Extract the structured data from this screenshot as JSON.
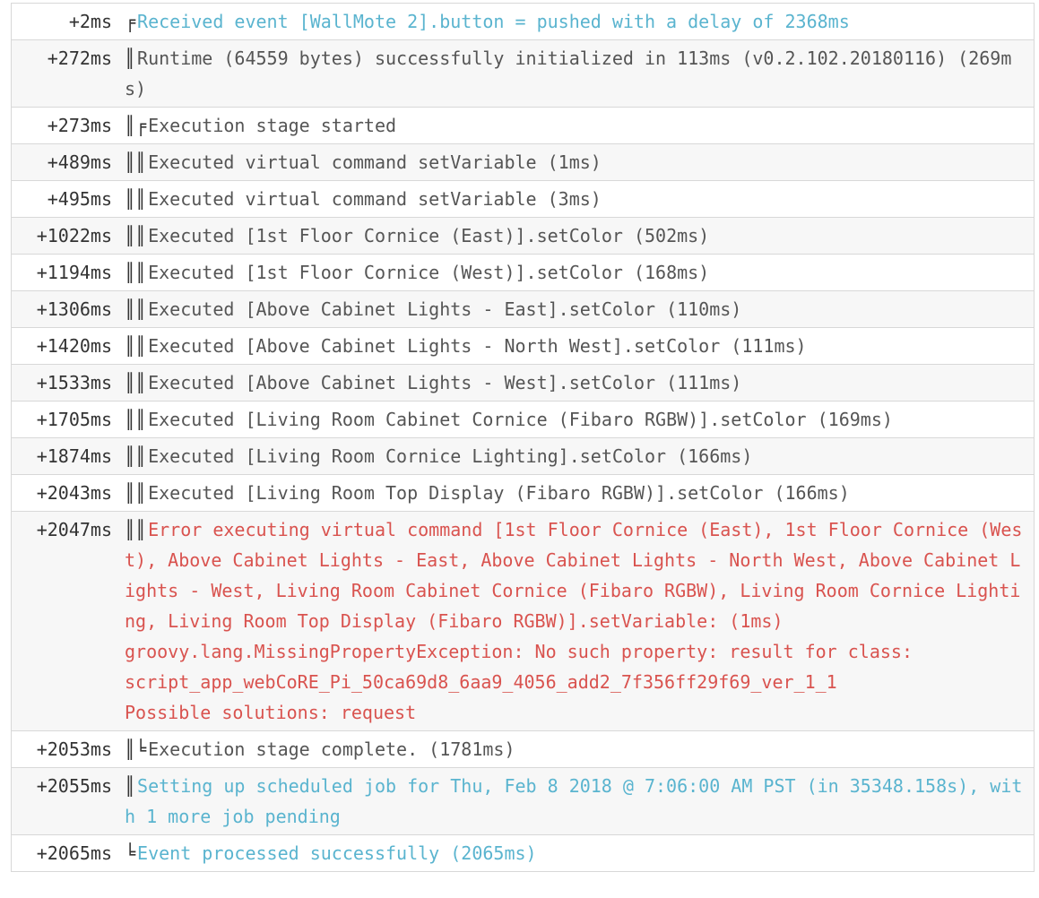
{
  "log": {
    "rows": [
      {
        "ts": "+2ms",
        "gutter": "╒",
        "msg": "Received event [WallMote 2].button = pushed with a delay of 2368ms",
        "level": "event"
      },
      {
        "ts": "+272ms",
        "gutter": "║",
        "msg": "Runtime (64559 bytes) successfully initialized in 113ms (v0.2.102.20180116) (269ms)",
        "level": "info"
      },
      {
        "ts": "+273ms",
        "gutter": "║╒",
        "msg": "Execution stage started",
        "level": "info"
      },
      {
        "ts": "+489ms",
        "gutter": "║║",
        "msg": "Executed virtual command setVariable (1ms)",
        "level": "info"
      },
      {
        "ts": "+495ms",
        "gutter": "║║",
        "msg": "Executed virtual command setVariable (3ms)",
        "level": "info"
      },
      {
        "ts": "+1022ms",
        "gutter": "║║",
        "msg": "Executed [1st Floor Cornice (East)].setColor (502ms)",
        "level": "info"
      },
      {
        "ts": "+1194ms",
        "gutter": "║║",
        "msg": "Executed [1st Floor Cornice (West)].setColor (168ms)",
        "level": "info"
      },
      {
        "ts": "+1306ms",
        "gutter": "║║",
        "msg": "Executed [Above Cabinet Lights - East].setColor (110ms)",
        "level": "info"
      },
      {
        "ts": "+1420ms",
        "gutter": "║║",
        "msg": "Executed [Above Cabinet Lights - North West].setColor (111ms)",
        "level": "info"
      },
      {
        "ts": "+1533ms",
        "gutter": "║║",
        "msg": "Executed [Above Cabinet Lights - West].setColor (111ms)",
        "level": "info"
      },
      {
        "ts": "+1705ms",
        "gutter": "║║",
        "msg": "Executed [Living Room Cabinet Cornice (Fibaro RGBW)].setColor (169ms)",
        "level": "info"
      },
      {
        "ts": "+1874ms",
        "gutter": "║║",
        "msg": "Executed [Living Room Cornice Lighting].setColor (166ms)",
        "level": "info"
      },
      {
        "ts": "+2043ms",
        "gutter": "║║",
        "msg": "Executed [Living Room Top Display (Fibaro RGBW)].setColor (166ms)",
        "level": "info"
      },
      {
        "ts": "+2047ms",
        "gutter": "║║",
        "msg": "Error executing virtual command [1st Floor Cornice (East), 1st Floor Cornice (West), Above Cabinet Lights - East, Above Cabinet Lights - North West, Above Cabinet Lights - West, Living Room Cabinet Cornice (Fibaro RGBW), Living Room Cornice Lighting, Living Room Top Display (Fibaro RGBW)].setVariable: (1ms)\ngroovy.lang.MissingPropertyException: No such property: result for class:\nscript_app_webCoRE_Pi_50ca69d8_6aa9_4056_add2_7f356ff29f69_ver_1_1\nPossible solutions: request",
        "level": "error"
      },
      {
        "ts": "+2053ms",
        "gutter": "║╘",
        "msg": "Execution stage complete. (1781ms)",
        "level": "info"
      },
      {
        "ts": "+2055ms",
        "gutter": "║",
        "msg": "Setting up scheduled job for Thu, Feb 8 2018 @ 7:06:00 AM PST (in 35348.158s), with 1 more job pending",
        "level": "event"
      },
      {
        "ts": "+2065ms",
        "gutter": "╘",
        "msg": "Event processed successfully (2065ms)",
        "level": "event"
      }
    ]
  },
  "colors": {
    "event": "#5ab4cf",
    "info": "#555555",
    "error": "#d9534f"
  }
}
